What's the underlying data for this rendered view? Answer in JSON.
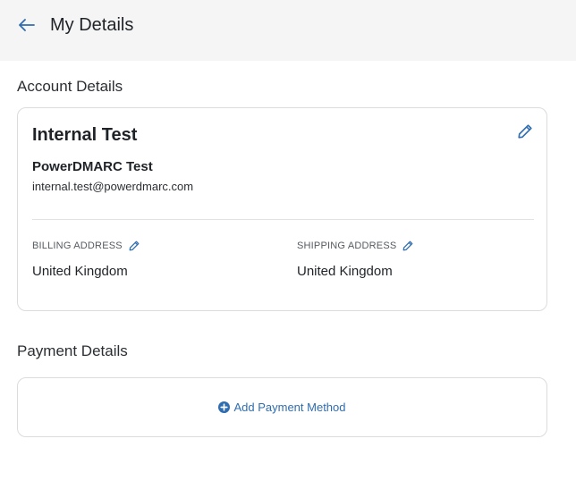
{
  "header": {
    "title": "My Details",
    "back_icon": "arrow-left-icon"
  },
  "account": {
    "section_title": "Account Details",
    "name": "Internal Test",
    "company": "PowerDMARC Test",
    "email": "internal.test@powerdmarc.com",
    "billing_label": "BILLING ADDRESS",
    "billing_value": "United Kingdom",
    "shipping_label": "SHIPPING ADDRESS",
    "shipping_value": "United Kingdom"
  },
  "payment": {
    "section_title": "Payment Details",
    "add_label": "Add Payment Method"
  },
  "colors": {
    "accent": "#2f6db0",
    "header_bg": "#f5f5f5",
    "border": "#dcdcdc"
  }
}
